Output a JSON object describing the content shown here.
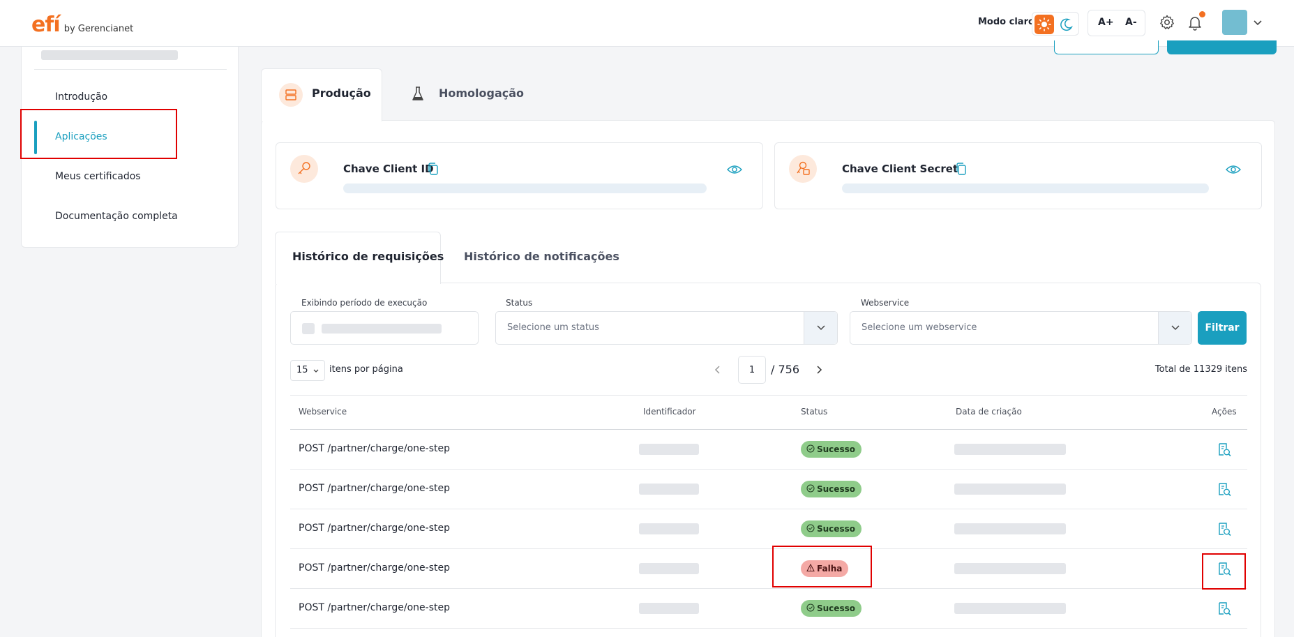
{
  "header": {
    "logo_main": "efí",
    "logo_sub": "by Gerencianet",
    "mode_label": "Modo claro",
    "font_increase": "A+",
    "font_decrease": "A-"
  },
  "sidebar": {
    "items": [
      {
        "label": "Introdução"
      },
      {
        "label": "Aplicações"
      },
      {
        "label": "Meus certificados"
      },
      {
        "label": "Documentação completa"
      }
    ]
  },
  "env_tabs": [
    {
      "label": "Produção"
    },
    {
      "label": "Homologação"
    }
  ],
  "keys": {
    "client_id_label": "Chave Client ID",
    "client_secret_label": "Chave Client Secret"
  },
  "history_tabs": [
    {
      "label": "Histórico de requisições"
    },
    {
      "label": "Histórico de notificações"
    }
  ],
  "filters": {
    "period_label": "Exibindo período de execução",
    "status_label": "Status",
    "status_placeholder": "Selecione um status",
    "webservice_label": "Webservice",
    "webservice_placeholder": "Selecione um webservice",
    "filter_button": "Filtrar"
  },
  "pagination": {
    "per_page": "15",
    "per_page_label": "itens por página",
    "current_page": "1",
    "total_pages": "/ 756",
    "total_label": "Total de 11329 itens"
  },
  "table": {
    "headers": [
      "Webservice",
      "Identificador",
      "Status",
      "Data de criação",
      "Ações"
    ],
    "rows": [
      {
        "webservice": "POST /partner/charge/one-step",
        "status": "Sucesso"
      },
      {
        "webservice": "POST /partner/charge/one-step",
        "status": "Sucesso"
      },
      {
        "webservice": "POST /partner/charge/one-step",
        "status": "Sucesso"
      },
      {
        "webservice": "POST /partner/charge/one-step",
        "status": "Falha"
      },
      {
        "webservice": "POST /partner/charge/one-step",
        "status": "Sucesso"
      }
    ]
  },
  "colors": {
    "accent": "#1a9fbf",
    "brand": "#f37021",
    "success": "#8fcc8a",
    "failure": "#f4a9a5",
    "highlight": "#e00000"
  },
  "icons": {
    "theme_light": "sun-icon",
    "theme_dark": "moon-icon",
    "settings": "gear-icon",
    "notifications": "bell-icon",
    "key": "key-icon",
    "secret": "lock-key-icon",
    "copy": "copy-icon",
    "reveal": "eye-icon",
    "action": "search-document-icon"
  }
}
